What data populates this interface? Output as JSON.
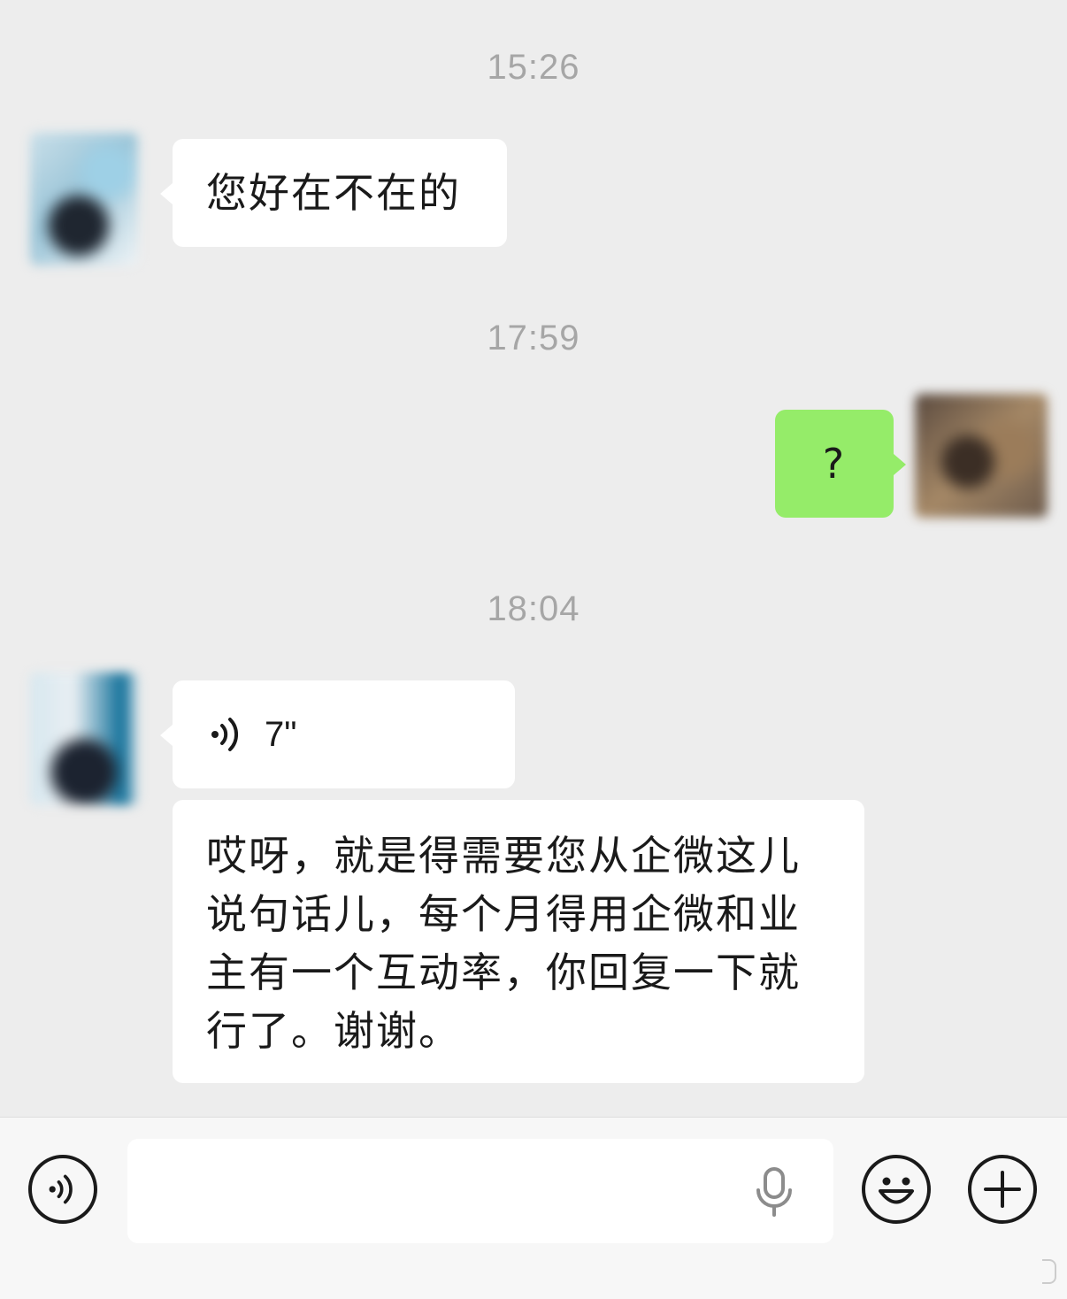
{
  "messages": {
    "ts1": "15:26",
    "m1_text": "您好在不在的",
    "ts2": "17:59",
    "m2_text": "?",
    "ts3": "18:04",
    "m3_voice_duration": "7\"",
    "m4_text": "哎呀，就是得需要您从企微这儿说句话儿，每个月得用企微和业主有一个互动率，你回复一下就行了。谢谢。"
  },
  "input": {
    "placeholder": ""
  },
  "icons": {
    "voice_toggle": "voice-mode-icon",
    "mic": "microphone-icon",
    "emoji": "emoji-icon",
    "more": "plus-icon",
    "voice_msg": "voice-wave-icon"
  },
  "colors": {
    "background": "#ededed",
    "incoming_bubble": "#ffffff",
    "outgoing_bubble": "#95ec69",
    "timestamp": "#a6a6a6"
  }
}
